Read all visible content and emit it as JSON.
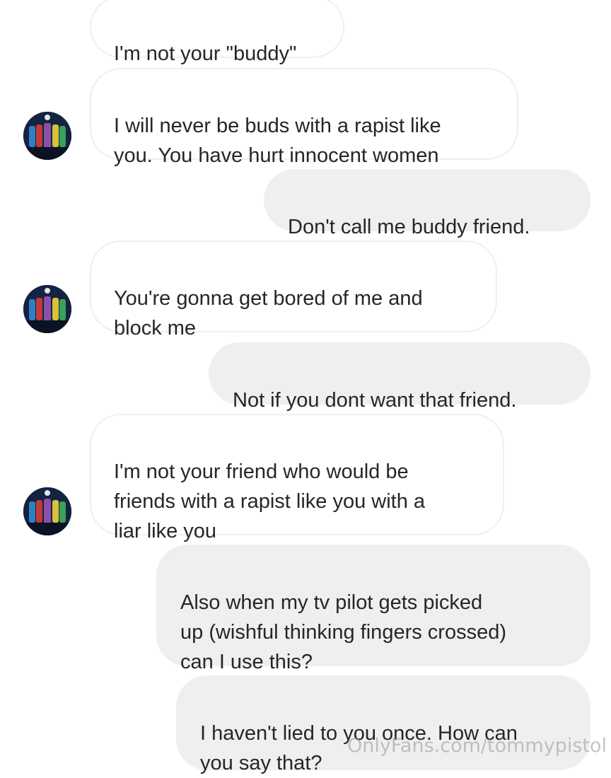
{
  "conversation": {
    "messages": [
      {
        "side": "in",
        "text": "I'm not your \"buddy\""
      },
      {
        "side": "in",
        "text": "I will never be buds with a rapist like\nyou. You have hurt innocent women"
      },
      {
        "side": "out",
        "text": "Don't call me buddy friend."
      },
      {
        "side": "in",
        "text": "You're gonna get bored of me and\nblock me"
      },
      {
        "side": "out",
        "text": "Not if you dont want that friend."
      },
      {
        "side": "in",
        "text": "I'm not your friend who would be\nfriends with a rapist like you with a\nliar like you"
      },
      {
        "side": "out",
        "text": "Also when my tv pilot gets picked\nup (wishful thinking fingers crossed)\ncan I use this?"
      },
      {
        "side": "out",
        "text": "I haven't lied to you once. How can\nyou say that?"
      }
    ],
    "avatar_icon": "group-photo-avatar-icon"
  },
  "watermark": {
    "text": "OnlyFans.com/tommypistol"
  },
  "colors": {
    "incoming_bg": "#ffffff",
    "incoming_border": "#efefef",
    "outgoing_bg": "#efefef",
    "text": "#262626"
  }
}
